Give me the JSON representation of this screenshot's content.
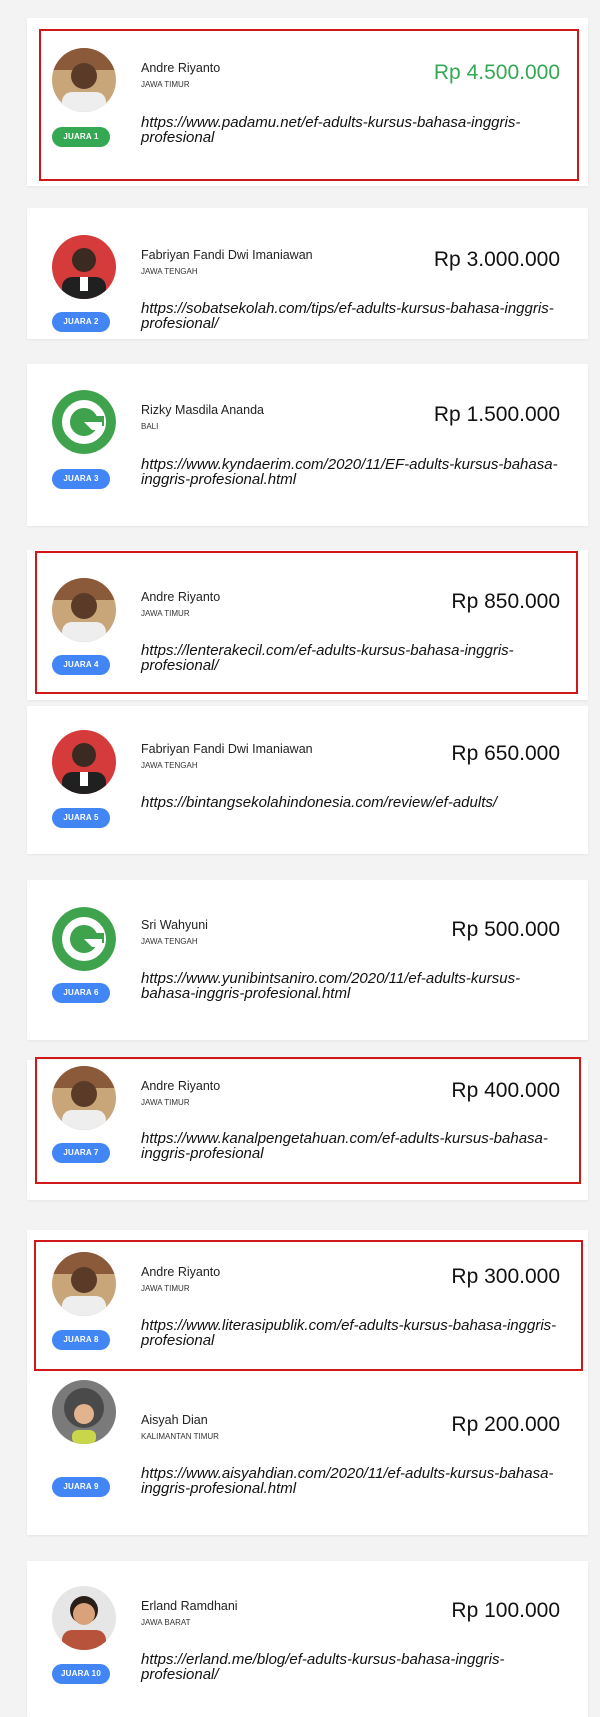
{
  "colors": {
    "badge_blue": "#4285f4",
    "badge_green": "#34a853",
    "prize_highlight": "#34a853",
    "highlight_border": "#d01818"
  },
  "entries": [
    {
      "name": "Andre Riyanto",
      "region": "JAWA TIMUR",
      "prize": "Rp 4.500.000",
      "badge": "JUARA 1",
      "link": "https://www.padamu.net/ef-adults-kursus-bahasa-inggris-profesional",
      "avatar": "photo-man-avatar-icon"
    },
    {
      "name": "Fabriyan Fandi Dwi Imaniawan",
      "region": "JAWA TENGAH",
      "prize": "Rp 3.000.000",
      "badge": "JUARA 2",
      "link": "https://sobatsekolah.com/tips/ef-adults-kursus-bahasa-inggris-profesional/",
      "avatar": "photo-student-avatar-icon"
    },
    {
      "name": "Rizky Masdila Ananda",
      "region": "BALI",
      "prize": "Rp 1.500.000",
      "badge": "JUARA 3",
      "link": "https://www.kyndaerim.com/2020/11/EF-adults-kursus-bahasa-inggris-profesional.html",
      "avatar": "green-g-logo-icon"
    },
    {
      "name": "Andre Riyanto",
      "region": "JAWA TIMUR",
      "prize": "Rp 850.000",
      "badge": "JUARA 4",
      "link": "https://lenterakecil.com/ef-adults-kursus-bahasa-inggris-profesional/",
      "avatar": "photo-man-avatar-icon"
    },
    {
      "name": "Fabriyan Fandi Dwi Imaniawan",
      "region": "JAWA TENGAH",
      "prize": "Rp 650.000",
      "badge": "JUARA 5",
      "link": "https://bintangsekolahindonesia.com/review/ef-adults/",
      "avatar": "photo-student-avatar-icon"
    },
    {
      "name": "Sri Wahyuni",
      "region": "JAWA TENGAH",
      "prize": "Rp 500.000",
      "badge": "JUARA 6",
      "link": "https://www.yunibintsaniro.com/2020/11/ef-adults-kursus-bahasa-inggris-profesional.html",
      "avatar": "green-g-logo-icon"
    },
    {
      "name": "Andre Riyanto",
      "region": "JAWA TIMUR",
      "prize": "Rp 400.000",
      "badge": "JUARA 7",
      "link": "https://www.kanalpengetahuan.com/ef-adults-kursus-bahasa-inggris-profesional",
      "avatar": "photo-man-avatar-icon"
    },
    {
      "name": "Andre Riyanto",
      "region": "JAWA TIMUR",
      "prize": "Rp 300.000",
      "badge": "JUARA 8",
      "link": "https://www.literasipublik.com/ef-adults-kursus-bahasa-inggris-profesional",
      "avatar": "photo-man-avatar-icon"
    },
    {
      "name": "Aisyah Dian",
      "region": "KALIMANTAN TIMUR",
      "prize": "Rp 200.000",
      "badge": "JUARA 9",
      "link": "https://www.aisyahdian.com/2020/11/ef-adults-kursus-bahasa-inggris-profesional.html",
      "avatar": "photo-woman-avatar-icon"
    },
    {
      "name": "Erland Ramdhani",
      "region": "JAWA BARAT",
      "prize": "Rp 100.000",
      "badge": "JUARA 10",
      "link": "https://erland.me/blog/ef-adults-kursus-bahasa-inggris-profesional/",
      "avatar": "photo-boy-avatar-icon"
    }
  ]
}
